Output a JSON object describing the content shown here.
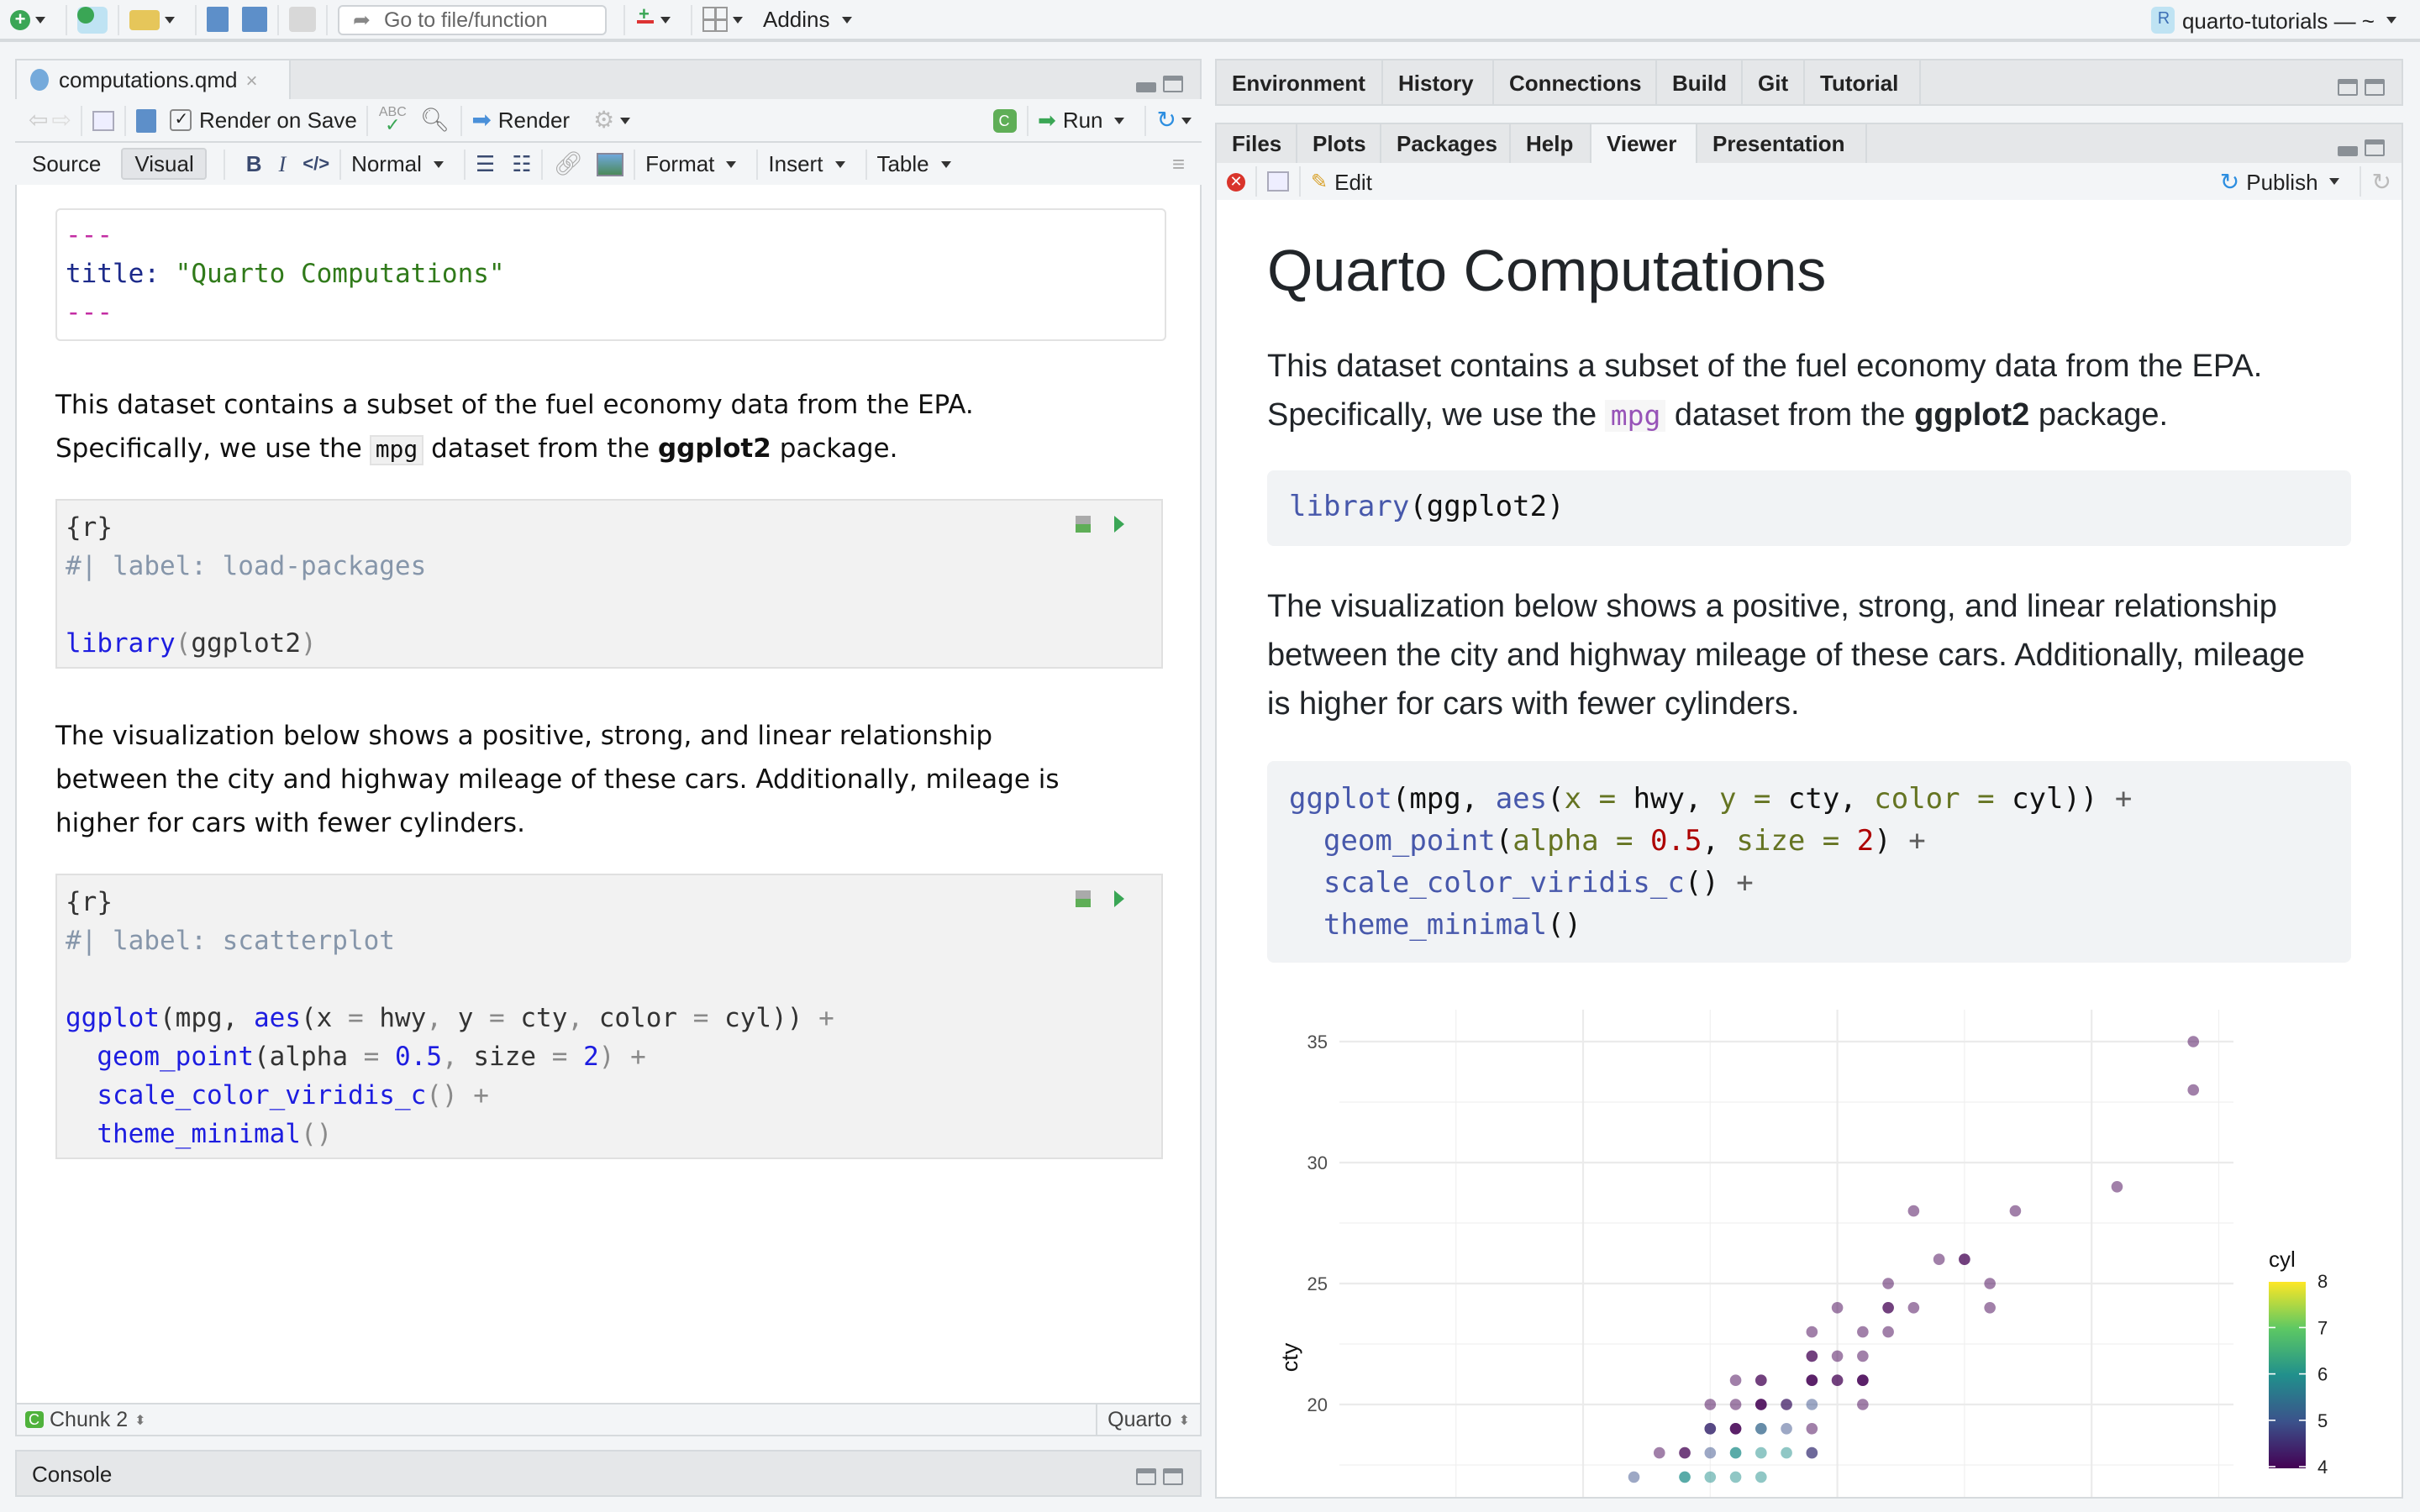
{
  "toolbar": {
    "goto_placeholder": "Go to file/function",
    "addins_label": "Addins",
    "project_label": "quarto-tutorials — ~"
  },
  "editor": {
    "tab_label": "computations.qmd",
    "render_on_save_label": "Render on Save",
    "render_on_save_checked": true,
    "render_label": "Render",
    "run_label": "Run",
    "mode_source": "Source",
    "mode_visual": "Visual",
    "active_mode": "Visual",
    "bold_label": "B",
    "italic_label": "I",
    "code_label": "</>",
    "style_select": "Normal",
    "format_label": "Format",
    "insert_label": "Insert",
    "table_label": "Table",
    "yaml_lines": [
      [
        [
          "---",
          "t-yaml-dash"
        ]
      ],
      [
        [
          "title: ",
          "t-yaml-key"
        ],
        [
          "\"Quarto Computations\"",
          "t-str"
        ]
      ],
      [
        [
          "---",
          "t-yaml-dash"
        ]
      ]
    ],
    "para1": {
      "line1": "This dataset contains a subset of the fuel economy data from the EPA.",
      "l2a": "Specifically, we use the ",
      "code": "mpg",
      "l2b": " dataset from the ",
      "bold": "ggplot2",
      "l2c": " package."
    },
    "chunk1_lines": [
      [
        [
          "{r}",
          "t-pl"
        ]
      ],
      [
        [
          "#| label: load-packages",
          "t-cm"
        ]
      ],
      [],
      [
        [
          "library",
          "t-fn"
        ],
        [
          "(",
          "t-op"
        ],
        [
          "ggplot2",
          "t-pl"
        ],
        [
          ")",
          "t-op"
        ]
      ]
    ],
    "para2": {
      "line1": "The visualization below shows a positive, strong, and linear relationship",
      "line2": "between the city and highway mileage of these cars. Additionally, mileage is",
      "line3": "higher for cars with fewer cylinders."
    },
    "chunk2_lines": [
      [
        [
          "{r}",
          "t-pl"
        ]
      ],
      [
        [
          "#| label: scatterplot",
          "t-cm"
        ]
      ],
      [],
      [
        [
          "ggplot",
          "t-fn"
        ],
        [
          "(mpg, ",
          "t-pl"
        ],
        [
          "aes",
          "t-fn"
        ],
        [
          "(x ",
          "t-pl"
        ],
        [
          "=",
          "t-op"
        ],
        [
          " hwy",
          "t-pl"
        ],
        [
          ",",
          "t-op"
        ],
        [
          " y ",
          "t-pl"
        ],
        [
          "=",
          "t-op"
        ],
        [
          " cty",
          "t-pl"
        ],
        [
          ",",
          "t-op"
        ],
        [
          " color ",
          "t-pl"
        ],
        [
          "=",
          "t-op"
        ],
        [
          " cyl))",
          "t-pl"
        ],
        [
          " +",
          "t-op"
        ]
      ],
      [
        [
          "  ",
          "t-pl"
        ],
        [
          "geom_point",
          "t-fn"
        ],
        [
          "(alpha ",
          "t-pl"
        ],
        [
          "=",
          "t-op"
        ],
        [
          " ",
          "t-pl"
        ],
        [
          "0.5",
          "t-num"
        ],
        [
          ",",
          "t-op"
        ],
        [
          " size ",
          "t-pl"
        ],
        [
          "=",
          "t-op"
        ],
        [
          " ",
          "t-pl"
        ],
        [
          "2",
          "t-num"
        ],
        [
          ")",
          "t-op"
        ],
        [
          " +",
          "t-op"
        ]
      ],
      [
        [
          "  ",
          "t-pl"
        ],
        [
          "scale_color_viridis_c",
          "t-fn"
        ],
        [
          "()",
          "t-op"
        ],
        [
          " +",
          "t-op"
        ]
      ],
      [
        [
          "  ",
          "t-pl"
        ],
        [
          "theme_minimal",
          "t-fn"
        ],
        [
          "()",
          "t-op"
        ]
      ]
    ],
    "status_chunk": "Chunk 2",
    "status_chunk_badge": "C",
    "status_lang": "Quarto"
  },
  "console": {
    "label": "Console"
  },
  "top_right": {
    "tabs": [
      "Environment",
      "History",
      "Connections",
      "Build",
      "Git",
      "Tutorial"
    ]
  },
  "bottom_right": {
    "tabs": [
      "Files",
      "Plots",
      "Packages",
      "Help",
      "Viewer",
      "Presentation"
    ],
    "active_tab": "Viewer",
    "edit_label": "Edit",
    "publish_label": "Publish"
  },
  "viewer": {
    "title": "Quarto Computations",
    "para1": {
      "line1": "This dataset contains a subset of the fuel economy data from the EPA.",
      "l2a": "Specifically, we use the ",
      "code": "mpg",
      "l2b": " dataset from the ",
      "bold": "ggplot2",
      "l2c": " package."
    },
    "code1_lines": [
      [
        [
          "library",
          "v-fn"
        ],
        [
          "(ggplot2)",
          "v-pl"
        ]
      ]
    ],
    "para2": {
      "line1": "The visualization below shows a positive, strong, and linear relationship",
      "line2": "between the city and highway mileage of these cars. Additionally, mileage",
      "line3": "is higher for cars with fewer cylinders."
    },
    "code2_lines": [
      [
        [
          "ggplot",
          "v-fn"
        ],
        [
          "(mpg, ",
          "v-pl"
        ],
        [
          "aes",
          "v-fn"
        ],
        [
          "(",
          "v-pl"
        ],
        [
          "x",
          "v-arg"
        ],
        [
          " = ",
          "v-arg"
        ],
        [
          "hwy, ",
          "v-pl"
        ],
        [
          "y",
          "v-arg"
        ],
        [
          " = ",
          "v-arg"
        ],
        [
          "cty, ",
          "v-pl"
        ],
        [
          "color",
          "v-arg"
        ],
        [
          " = ",
          "v-arg"
        ],
        [
          "cyl)) ",
          "v-pl"
        ],
        [
          "+",
          "v-op"
        ]
      ],
      [
        [
          "  ",
          "v-pl"
        ],
        [
          "geom_point",
          "v-fn"
        ],
        [
          "(",
          "v-pl"
        ],
        [
          "alpha",
          "v-arg"
        ],
        [
          " = ",
          "v-arg"
        ],
        [
          "0.5",
          "v-num"
        ],
        [
          ", ",
          "v-pl"
        ],
        [
          "size",
          "v-arg"
        ],
        [
          " = ",
          "v-arg"
        ],
        [
          "2",
          "v-num"
        ],
        [
          ") ",
          "v-pl"
        ],
        [
          "+",
          "v-op"
        ]
      ],
      [
        [
          "  ",
          "v-pl"
        ],
        [
          "scale_color_viridis_c",
          "v-fn"
        ],
        [
          "() ",
          "v-pl"
        ],
        [
          "+",
          "v-op"
        ]
      ],
      [
        [
          "  ",
          "v-pl"
        ],
        [
          "theme_minimal",
          "v-fn"
        ],
        [
          "()",
          "v-pl"
        ]
      ]
    ]
  },
  "chart_data": {
    "type": "scatter",
    "xlabel": "",
    "ylabel": "cty",
    "xlim": [
      10.4,
      45.6
    ],
    "ylim_visible": [
      16.3,
      36.3
    ],
    "y_ticks": [
      20,
      25,
      30,
      35
    ],
    "x_major": [
      20,
      30,
      40
    ],
    "x_minor": [
      15,
      25,
      35,
      45
    ],
    "y_minor": [
      17.5,
      22.5,
      27.5,
      32.5
    ],
    "grid": true,
    "alpha": 0.5,
    "legend": {
      "title": "cyl",
      "ticks": [
        4,
        5,
        6,
        7,
        8
      ],
      "placement": "right",
      "colors": [
        "#440154",
        "#3B528B",
        "#21908C",
        "#5DC863",
        "#FDE725"
      ]
    },
    "points": [
      [
        22,
        17,
        5
      ],
      [
        24,
        17,
        6
      ],
      [
        24,
        17,
        6
      ],
      [
        25,
        17,
        6
      ],
      [
        26,
        17,
        6
      ],
      [
        27,
        17,
        6
      ],
      [
        23,
        18,
        4
      ],
      [
        24,
        18,
        4
      ],
      [
        24,
        18,
        4
      ],
      [
        25,
        18,
        5
      ],
      [
        26,
        18,
        6
      ],
      [
        26,
        18,
        6
      ],
      [
        27,
        18,
        6
      ],
      [
        28,
        18,
        6
      ],
      [
        29,
        18,
        4
      ],
      [
        29,
        18,
        5
      ],
      [
        25,
        19,
        4
      ],
      [
        25,
        19,
        4
      ],
      [
        25,
        19,
        5
      ],
      [
        26,
        19,
        4
      ],
      [
        26,
        19,
        4
      ],
      [
        26,
        19,
        4
      ],
      [
        27,
        19,
        6
      ],
      [
        27,
        19,
        5
      ],
      [
        28,
        19,
        5
      ],
      [
        29,
        19,
        4
      ],
      [
        25,
        20,
        4
      ],
      [
        26,
        20,
        4
      ],
      [
        27,
        20,
        4
      ],
      [
        27,
        20,
        4
      ],
      [
        27,
        20,
        4
      ],
      [
        28,
        20,
        5
      ],
      [
        28,
        20,
        4
      ],
      [
        29,
        20,
        5
      ],
      [
        31,
        20,
        4
      ],
      [
        26,
        21,
        4
      ],
      [
        27,
        21,
        4
      ],
      [
        27,
        21,
        4
      ],
      [
        29,
        21,
        4
      ],
      [
        29,
        21,
        4
      ],
      [
        29,
        21,
        4
      ],
      [
        30,
        21,
        4
      ],
      [
        30,
        21,
        4
      ],
      [
        31,
        21,
        4
      ],
      [
        31,
        21,
        4
      ],
      [
        31,
        21,
        4
      ],
      [
        29,
        22,
        4
      ],
      [
        29,
        22,
        4
      ],
      [
        30,
        22,
        4
      ],
      [
        31,
        22,
        4
      ],
      [
        29,
        23,
        4
      ],
      [
        31,
        23,
        4
      ],
      [
        32,
        23,
        4
      ],
      [
        30,
        24,
        4
      ],
      [
        32,
        24,
        4
      ],
      [
        32,
        24,
        4
      ],
      [
        33,
        24,
        4
      ],
      [
        36,
        24,
        4
      ],
      [
        32,
        25,
        4
      ],
      [
        36,
        25,
        4
      ],
      [
        34,
        26,
        4
      ],
      [
        35,
        26,
        4
      ],
      [
        35,
        26,
        4
      ],
      [
        33,
        28,
        4
      ],
      [
        37,
        28,
        4
      ],
      [
        41,
        29,
        4
      ],
      [
        44,
        33,
        4
      ],
      [
        44,
        35,
        4
      ]
    ]
  }
}
